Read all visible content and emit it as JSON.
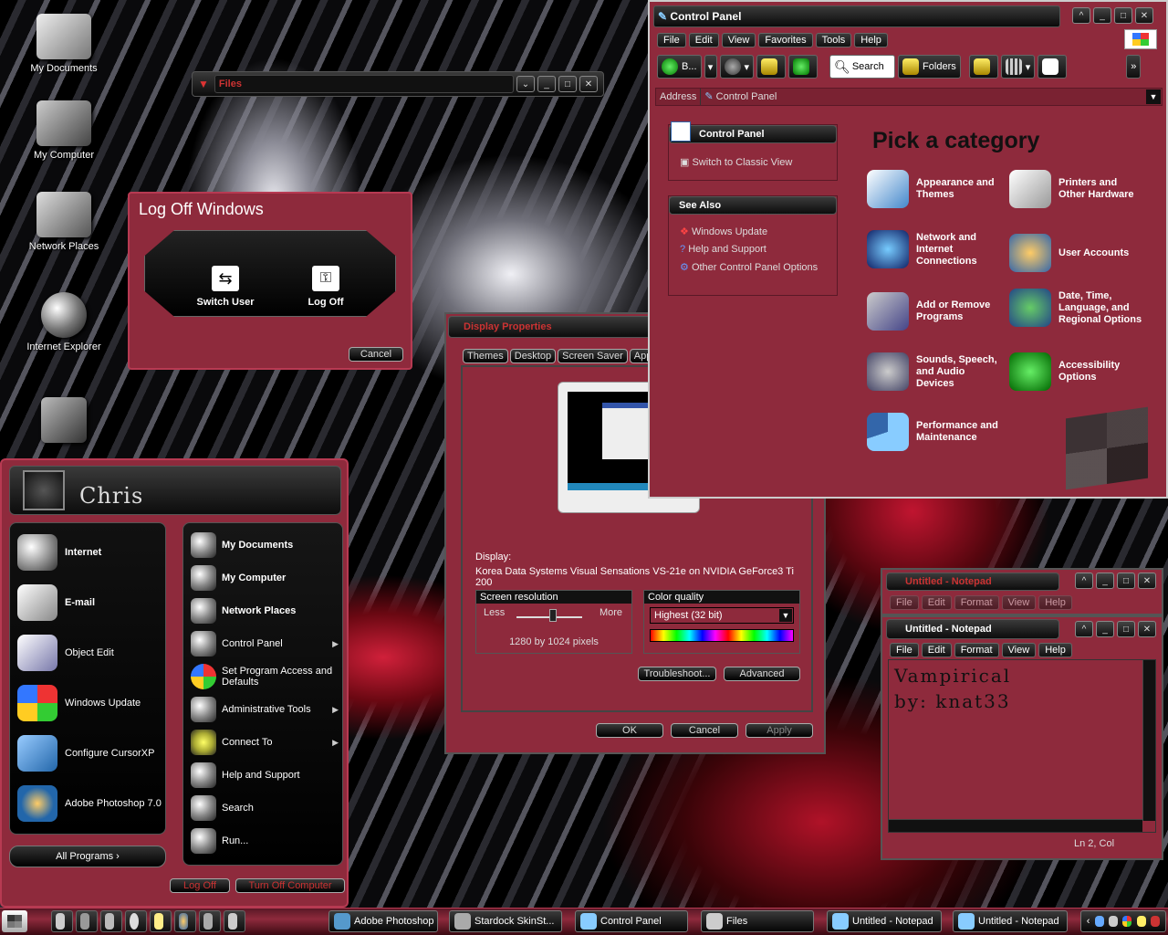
{
  "desktop_icons": [
    {
      "label": "My Documents"
    },
    {
      "label": "My Computer"
    },
    {
      "label": "Network Places"
    },
    {
      "label": "Internet Explorer"
    }
  ],
  "files_window": {
    "title": "Files"
  },
  "logoff": {
    "title": "Log Off Windows",
    "switch_user": "Switch User",
    "log_off": "Log Off",
    "cancel": "Cancel"
  },
  "start_menu": {
    "user": "Chris",
    "pinned": [
      {
        "label": "Internet",
        "bold": true
      },
      {
        "label": "E-mail",
        "bold": true
      },
      {
        "label": "Object Edit"
      },
      {
        "label": "Windows Update"
      },
      {
        "label": "Configure CursorXP"
      },
      {
        "label": "Adobe Photoshop 7.0"
      }
    ],
    "all_programs": "All Programs",
    "right": [
      {
        "label": "My Documents",
        "bold": true
      },
      {
        "label": "My Computer",
        "bold": true
      },
      {
        "label": "Network Places",
        "bold": true
      },
      {
        "label": "Control Panel"
      },
      {
        "label": "Set Program Access and Defaults"
      },
      {
        "label": "Administrative Tools"
      },
      {
        "label": "Connect To"
      },
      {
        "label": "Help and Support"
      },
      {
        "label": "Search"
      },
      {
        "label": "Run..."
      }
    ],
    "log_off": "Log Off",
    "turn_off": "Turn Off Computer"
  },
  "display_props": {
    "title": "Display Properties",
    "tabs": [
      "Themes",
      "Desktop",
      "Screen Saver",
      "Appeara"
    ],
    "display_label": "Display:",
    "display_value": "Korea Data Systems Visual Sensations VS-21e on NVIDIA GeForce3 Ti 200",
    "res_title": "Screen resolution",
    "less": "Less",
    "more": "More",
    "res_value": "1280 by 1024 pixels",
    "color_title": "Color quality",
    "color_value": "Highest (32 bit)",
    "troubleshoot": "Troubleshoot...",
    "advanced": "Advanced",
    "ok": "OK",
    "cancel": "Cancel",
    "apply": "Apply"
  },
  "control_panel": {
    "title": "Control Panel",
    "menu": [
      "File",
      "Edit",
      "View",
      "Favorites",
      "Tools",
      "Help"
    ],
    "back": "B...",
    "search": "Search",
    "folders": "Folders",
    "address_label": "Address",
    "address_value": "Control Panel",
    "side_title": "Control Panel",
    "switch_view": "Switch to Classic View",
    "see_also": "See Also",
    "see_also_items": [
      "Windows Update",
      "Help and Support",
      "Other Control Panel Options"
    ],
    "heading": "Pick a category",
    "categories": [
      "Appearance and Themes",
      "Printers and Other Hardware",
      "Network and Internet Connections",
      "User Accounts",
      "Add or Remove Programs",
      "Date, Time, Language, and Regional Options",
      "Sounds, Speech, and Audio Devices",
      "Accessibility Options",
      "Performance and Maintenance"
    ]
  },
  "notepad_back": {
    "title": "Untitled - Notepad",
    "menu": [
      "File",
      "Edit",
      "Format",
      "View",
      "Help"
    ]
  },
  "notepad": {
    "title": "Untitled - Notepad",
    "menu": [
      "File",
      "Edit",
      "Format",
      "View",
      "Help"
    ],
    "line1": "Vampirical",
    "line2": "by:  knat33",
    "status": "Ln 2, Col"
  },
  "taskbar": {
    "tasks": [
      "Adobe Photoshop",
      "Stardock SkinSt...",
      "Control Panel",
      "Files",
      "Untitled - Notepad",
      "Untitled - Notepad"
    ]
  },
  "colors": {
    "accent": "#8e2a3c",
    "border": "#b73a52"
  }
}
